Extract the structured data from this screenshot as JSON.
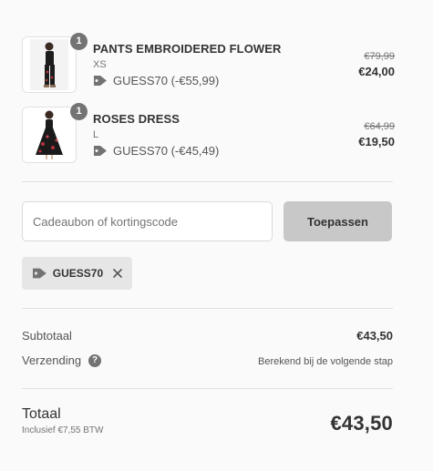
{
  "items": [
    {
      "quantity": "1",
      "name": "PANTS EMBROIDERED FLOWER",
      "variant": "XS",
      "discount": "GUESS70 (-€55,99)",
      "original_price": "€79,99",
      "price": "€24,00",
      "image_icon": "pants-product-image"
    },
    {
      "quantity": "1",
      "name": "ROSES DRESS",
      "variant": "L",
      "discount": "GUESS70 (-€45,49)",
      "original_price": "€64,99",
      "price": "€19,50",
      "image_icon": "dress-product-image"
    }
  ],
  "discount_form": {
    "placeholder": "Cadeaubon of kortingscode",
    "value": "",
    "apply_label": "Toepassen"
  },
  "applied_code": {
    "code": "GUESS70",
    "icon": "tag-icon",
    "remove_icon": "close-icon"
  },
  "totals": {
    "subtotal_label": "Subtotaal",
    "subtotal_value": "€43,50",
    "shipping_label": "Verzending",
    "shipping_help": "?",
    "shipping_value": "Berekend bij de volgende stap",
    "total_label": "Totaal",
    "tax_note": "Inclusief €7,55 BTW",
    "total_value": "€43,50"
  },
  "colors": {
    "background": "#fafafa",
    "badge": "#737373",
    "button_disabled": "#c8c8c8",
    "tag_background": "#e6e6e6"
  }
}
